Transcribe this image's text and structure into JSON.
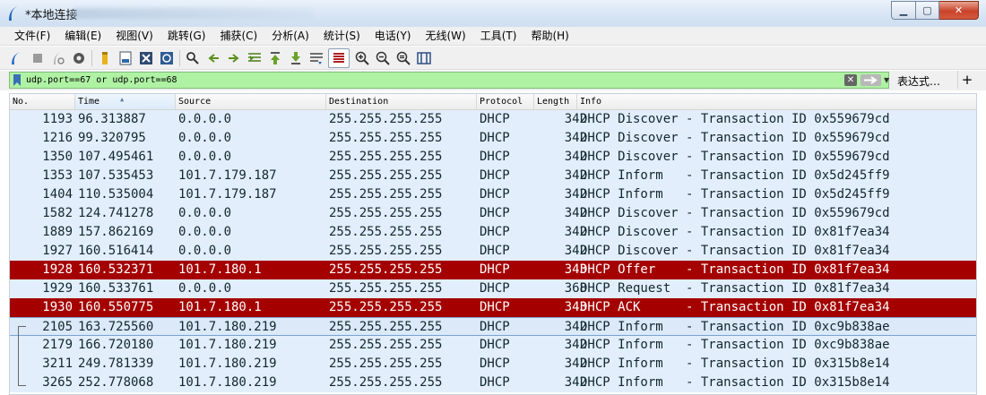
{
  "window": {
    "title": "*本地连接"
  },
  "menu": [
    "文件(F)",
    "编辑(E)",
    "视图(V)",
    "跳转(G)",
    "捕获(C)",
    "分析(A)",
    "统计(S)",
    "电话(Y)",
    "无线(W)",
    "工具(T)",
    "帮助(H)"
  ],
  "toolbar_icons": [
    "shark-fin-start-icon",
    "stop-icon",
    "restart-icon",
    "options-gear-icon",
    "open-folder-icon",
    "save-file-icon",
    "close-file-icon",
    "reload-icon",
    "find-icon",
    "back-arrow-icon",
    "forward-arrow-icon",
    "go-to-packet-icon",
    "first-packet-icon",
    "last-packet-icon",
    "autoscroll-icon",
    "colorize-icon",
    "zoom-in-icon",
    "zoom-out-icon",
    "zoom-normal-icon",
    "resize-columns-icon"
  ],
  "filter": {
    "value": "udp.port==67 or udp.port==68",
    "expression_label": "表达式…",
    "plus_label": "+"
  },
  "columns": [
    "No.",
    "Time",
    "Source",
    "Destination",
    "Protocol",
    "Length",
    "Info"
  ],
  "packets": [
    {
      "no": "1193",
      "time": "96.313887",
      "src": "0.0.0.0",
      "dst": "255.255.255.255",
      "proto": "DHCP",
      "len": "342",
      "info": "DHCP Discover - Transaction ID 0x559679cd",
      "style": "normal"
    },
    {
      "no": "1216",
      "time": "99.320795",
      "src": "0.0.0.0",
      "dst": "255.255.255.255",
      "proto": "DHCP",
      "len": "342",
      "info": "DHCP Discover - Transaction ID 0x559679cd",
      "style": "normal"
    },
    {
      "no": "1350",
      "time": "107.495461",
      "src": "0.0.0.0",
      "dst": "255.255.255.255",
      "proto": "DHCP",
      "len": "342",
      "info": "DHCP Discover - Transaction ID 0x559679cd",
      "style": "normal"
    },
    {
      "no": "1353",
      "time": "107.535453",
      "src": "101.7.179.187",
      "dst": "255.255.255.255",
      "proto": "DHCP",
      "len": "342",
      "info": "DHCP Inform   - Transaction ID 0x5d245ff9",
      "style": "normal"
    },
    {
      "no": "1404",
      "time": "110.535004",
      "src": "101.7.179.187",
      "dst": "255.255.255.255",
      "proto": "DHCP",
      "len": "342",
      "info": "DHCP Inform   - Transaction ID 0x5d245ff9",
      "style": "normal"
    },
    {
      "no": "1582",
      "time": "124.741278",
      "src": "0.0.0.0",
      "dst": "255.255.255.255",
      "proto": "DHCP",
      "len": "342",
      "info": "DHCP Discover - Transaction ID 0x559679cd",
      "style": "normal"
    },
    {
      "no": "1889",
      "time": "157.862169",
      "src": "0.0.0.0",
      "dst": "255.255.255.255",
      "proto": "DHCP",
      "len": "342",
      "info": "DHCP Discover - Transaction ID 0x81f7ea34",
      "style": "normal"
    },
    {
      "no": "1927",
      "time": "160.516414",
      "src": "0.0.0.0",
      "dst": "255.255.255.255",
      "proto": "DHCP",
      "len": "342",
      "info": "DHCP Discover - Transaction ID 0x81f7ea34",
      "style": "normal"
    },
    {
      "no": "1928",
      "time": "160.532371",
      "src": "101.7.180.1",
      "dst": "255.255.255.255",
      "proto": "DHCP",
      "len": "343",
      "info": "DHCP Offer    - Transaction ID 0x81f7ea34",
      "style": "red"
    },
    {
      "no": "1929",
      "time": "160.533761",
      "src": "0.0.0.0",
      "dst": "255.255.255.255",
      "proto": "DHCP",
      "len": "368",
      "info": "DHCP Request  - Transaction ID 0x81f7ea34",
      "style": "normal"
    },
    {
      "no": "1930",
      "time": "160.550775",
      "src": "101.7.180.1",
      "dst": "255.255.255.255",
      "proto": "DHCP",
      "len": "343",
      "info": "DHCP ACK      - Transaction ID 0x81f7ea34",
      "style": "red"
    },
    {
      "no": "2105",
      "time": "163.725560",
      "src": "101.7.180.219",
      "dst": "255.255.255.255",
      "proto": "DHCP",
      "len": "342",
      "info": "DHCP Inform   - Transaction ID 0xc9b838ae",
      "style": "selected"
    },
    {
      "no": "2179",
      "time": "166.720180",
      "src": "101.7.180.219",
      "dst": "255.255.255.255",
      "proto": "DHCP",
      "len": "342",
      "info": "DHCP Inform   - Transaction ID 0xc9b838ae",
      "style": "normal"
    },
    {
      "no": "3211",
      "time": "249.781339",
      "src": "101.7.180.219",
      "dst": "255.255.255.255",
      "proto": "DHCP",
      "len": "342",
      "info": "DHCP Inform   - Transaction ID 0x315b8e14",
      "style": "normal"
    },
    {
      "no": "3265",
      "time": "252.778068",
      "src": "101.7.180.219",
      "dst": "255.255.255.255",
      "proto": "DHCP",
      "len": "342",
      "info": "DHCP Inform   - Transaction ID 0x315b8e14",
      "style": "normal"
    }
  ],
  "colors": {
    "red_row": "#a40000",
    "normal_row": "#e2eefb",
    "filter_ok": "#aff2a4"
  }
}
